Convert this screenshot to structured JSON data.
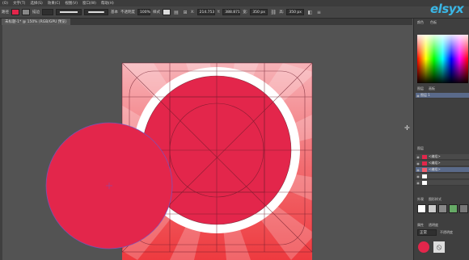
{
  "menubar": {
    "items": [
      "(O)",
      "文字(T)",
      "选择(S)",
      "效果(C)",
      "视图(V)",
      "窗口(W)",
      "帮助(H)"
    ]
  },
  "control_bar": {
    "left_label": "路径",
    "stroke_label": "描边",
    "stroke_value": "",
    "profile_label": "",
    "brush_label": "基本",
    "opacity_label": "不透明度",
    "opacity_value": "100%",
    "style_label": "样式",
    "x_value": "214.753",
    "y_value": "388.871",
    "w_value": "350 px",
    "h_value": "350 px"
  },
  "document_tab": {
    "label": "未标题-1* @ 150% (RGB/GPU 预览)"
  },
  "watermark": {
    "text": "elsyx"
  },
  "right_panel": {
    "color_tab": "颜色",
    "swatch_tab": "色板",
    "layers_tab": "图层",
    "artboards_tab": "画板",
    "layer_name": "图层 1",
    "layer_items": [
      "<编组>",
      "<编组>",
      "<编组>",
      "",
      ""
    ],
    "appearance_tab": "外观",
    "graphic_styles_tab": "图形样式",
    "attrs_tab": "属性",
    "transparency_tab": "透明度",
    "bottom_tab": "正常",
    "bottom_opacity_label": "不透明度"
  },
  "colors": {
    "accent_red": "#e3264b",
    "canvas_bg": "#535353",
    "panel_bg": "#3f3f3f",
    "watermark": "#3ab7e6"
  }
}
